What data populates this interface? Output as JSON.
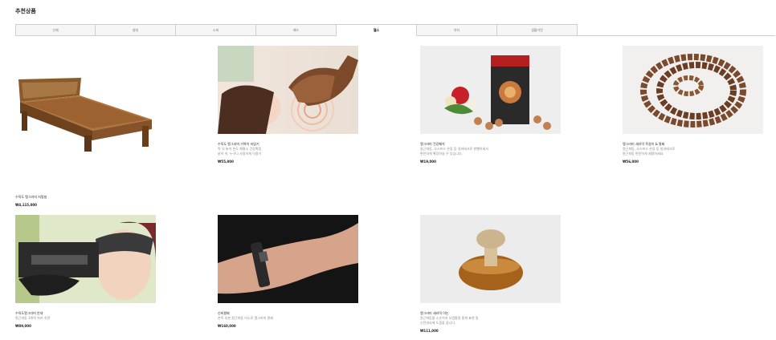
{
  "section": {
    "title": "추천상품"
  },
  "tabs": [
    "신제",
    "침대",
    "소파",
    "패드",
    "헬스",
    "의자",
    "생활가전"
  ],
  "active_tab_index": 4,
  "products": [
    {
      "name": "수직도 맹그라미 지팡침",
      "desc": "",
      "desc2": "",
      "price": "₩4,115,000",
      "image": "bed"
    },
    {
      "name": "수직도 맹그라미 거북이 지압기",
      "desc": "목 뒤 놓아 온도 해평소 건강확립",
      "desc2": "낱이 쉬. 누구나 사람하게 이용가",
      "price": "₩55,000",
      "image": "massager"
    },
    {
      "name": "맹그라미 건강패치",
      "desc": "원근파동, 오스프스 온류 등 영과테크로 밝뺀하세서",
      "desc2": "편안하게 확장하실 수 있습니다.",
      "price": "₩19,000",
      "image": "patch"
    },
    {
      "name": "맹그라미 세라믹 목걸이 & 팔찌",
      "desc": "원근파동, 오스프스 온류 등 방과테크로",
      "desc2": "원근파동 편안하게 제명하세요",
      "price": "₩56,000",
      "image": "beads"
    },
    {
      "name": "수직도맹그라미 안대",
      "desc": "원근파동 3개혁 쉬러 숙면",
      "desc2": "",
      "price": "₩89,000",
      "image": "eyemask"
    },
    {
      "name": "신비팔찌",
      "desc": "손목 부분 원근파동 미소로 맹그라미 팔찌",
      "desc2": "",
      "price": "₩160,000",
      "image": "bracelet"
    },
    {
      "name": "맹그라미 세라믹 이논",
      "desc": "원근파동을 소순이지 오염물질 원게 표현 및",
      "desc2": "신진대사에 도움을 줍니다.",
      "price": "₩111,000",
      "image": "ion"
    }
  ],
  "colors": {
    "border": "#cfcfcf",
    "tab_bg": "#f6f6f6",
    "text": "#222222",
    "muted": "#888888"
  }
}
